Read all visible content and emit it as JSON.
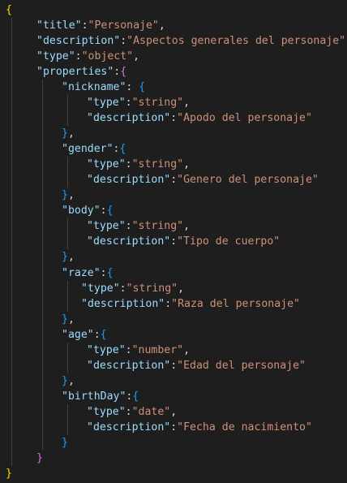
{
  "editor": {
    "language": "json",
    "theme": {
      "background": "#1e1e1e",
      "key_color": "#9cdcfe",
      "string_color": "#ce9178",
      "punctuation_color": "#d4d4d4",
      "brace_colors": [
        "#ffd700",
        "#da70d6",
        "#179fff"
      ],
      "indent_guide_color": "#404040"
    },
    "lines": [
      [
        {
          "t": "{",
          "c": "brace1"
        }
      ],
      [
        {
          "t": "\"title\"",
          "c": "key"
        },
        {
          "t": ":",
          "c": "punc"
        },
        {
          "t": "\"Personaje\"",
          "c": "str"
        },
        {
          "t": ",",
          "c": "punc"
        }
      ],
      [
        {
          "t": "\"description\"",
          "c": "key"
        },
        {
          "t": ":",
          "c": "punc"
        },
        {
          "t": "\"Aspectos generales del personaje\"",
          "c": "str"
        },
        {
          "t": ",",
          "c": "punc"
        }
      ],
      [
        {
          "t": "\"type\"",
          "c": "key"
        },
        {
          "t": ":",
          "c": "punc"
        },
        {
          "t": "\"object\"",
          "c": "str"
        },
        {
          "t": ",",
          "c": "punc"
        }
      ],
      [
        {
          "t": "\"properties\"",
          "c": "key"
        },
        {
          "t": ":",
          "c": "punc"
        },
        {
          "t": "{",
          "c": "brace2"
        }
      ],
      [
        {
          "t": "\"nickname\"",
          "c": "key"
        },
        {
          "t": ": ",
          "c": "punc"
        },
        {
          "t": "{",
          "c": "brace3"
        }
      ],
      [
        {
          "t": "\"type\"",
          "c": "key"
        },
        {
          "t": ":",
          "c": "punc"
        },
        {
          "t": "\"string\"",
          "c": "str"
        },
        {
          "t": ",",
          "c": "punc"
        }
      ],
      [
        {
          "t": "\"description\"",
          "c": "key"
        },
        {
          "t": ":",
          "c": "punc"
        },
        {
          "t": "\"Apodo del personaje\"",
          "c": "str"
        }
      ],
      [
        {
          "t": "}",
          "c": "brace3"
        },
        {
          "t": ",",
          "c": "punc"
        }
      ],
      [
        {
          "t": "\"gender\"",
          "c": "key"
        },
        {
          "t": ":",
          "c": "punc"
        },
        {
          "t": "{",
          "c": "brace3"
        }
      ],
      [
        {
          "t": "\"type\"",
          "c": "key"
        },
        {
          "t": ":",
          "c": "punc"
        },
        {
          "t": "\"string\"",
          "c": "str"
        },
        {
          "t": ",",
          "c": "punc"
        }
      ],
      [
        {
          "t": "\"description\"",
          "c": "key"
        },
        {
          "t": ":",
          "c": "punc"
        },
        {
          "t": "\"Genero del personaje\"",
          "c": "str"
        }
      ],
      [
        {
          "t": "}",
          "c": "brace3"
        },
        {
          "t": ",",
          "c": "punc"
        }
      ],
      [
        {
          "t": "\"body\"",
          "c": "key"
        },
        {
          "t": ":",
          "c": "punc"
        },
        {
          "t": "{",
          "c": "brace3"
        }
      ],
      [
        {
          "t": "\"type\"",
          "c": "key"
        },
        {
          "t": ":",
          "c": "punc"
        },
        {
          "t": "\"string\"",
          "c": "str"
        },
        {
          "t": ",",
          "c": "punc"
        }
      ],
      [
        {
          "t": "\"description\"",
          "c": "key"
        },
        {
          "t": ":",
          "c": "punc"
        },
        {
          "t": "\"Tipo de cuerpo\"",
          "c": "str"
        }
      ],
      [
        {
          "t": "}",
          "c": "brace3"
        },
        {
          "t": ",",
          "c": "punc"
        }
      ],
      [
        {
          "t": "\"raze\"",
          "c": "key"
        },
        {
          "t": ":",
          "c": "punc"
        },
        {
          "t": "{",
          "c": "brace3"
        }
      ],
      [
        {
          "t": "\"type\"",
          "c": "key"
        },
        {
          "t": ":",
          "c": "punc"
        },
        {
          "t": "\"string\"",
          "c": "str"
        },
        {
          "t": ",",
          "c": "punc"
        }
      ],
      [
        {
          "t": "\"description\"",
          "c": "key"
        },
        {
          "t": ":",
          "c": "punc"
        },
        {
          "t": "\"Raza del personaje\"",
          "c": "str"
        }
      ],
      [
        {
          "t": "}",
          "c": "brace3"
        },
        {
          "t": ",",
          "c": "punc"
        }
      ],
      [
        {
          "t": "\"age\"",
          "c": "key"
        },
        {
          "t": ":",
          "c": "punc"
        },
        {
          "t": "{",
          "c": "brace3"
        }
      ],
      [
        {
          "t": "\"type\"",
          "c": "key"
        },
        {
          "t": ":",
          "c": "punc"
        },
        {
          "t": "\"number\"",
          "c": "str"
        },
        {
          "t": ",",
          "c": "punc"
        }
      ],
      [
        {
          "t": "\"description\"",
          "c": "key"
        },
        {
          "t": ":",
          "c": "punc"
        },
        {
          "t": "\"Edad del personaje\"",
          "c": "str"
        }
      ],
      [
        {
          "t": "}",
          "c": "brace3"
        },
        {
          "t": ",",
          "c": "punc"
        }
      ],
      [
        {
          "t": "\"birthDay\"",
          "c": "key"
        },
        {
          "t": ":",
          "c": "punc"
        },
        {
          "t": "{",
          "c": "brace3"
        }
      ],
      [
        {
          "t": "\"type\"",
          "c": "key"
        },
        {
          "t": ":",
          "c": "punc"
        },
        {
          "t": "\"date\"",
          "c": "str"
        },
        {
          "t": ",",
          "c": "punc"
        }
      ],
      [
        {
          "t": "\"description\"",
          "c": "key"
        },
        {
          "t": ":",
          "c": "punc"
        },
        {
          "t": "\"Fecha de nacimiento\"",
          "c": "str"
        }
      ],
      [
        {
          "t": "}",
          "c": "brace3"
        }
      ],
      [
        {
          "t": "}",
          "c": "brace2"
        }
      ],
      [
        {
          "t": "}",
          "c": "brace1"
        }
      ]
    ]
  }
}
